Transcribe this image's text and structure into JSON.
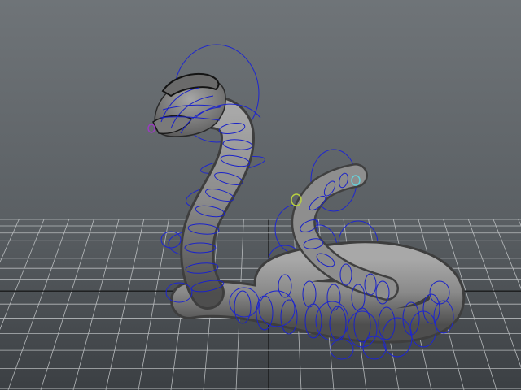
{
  "viewport": {
    "name": "3d-perspective-viewport",
    "background_top": "#6f7478",
    "background_bottom": "#3b3f43",
    "grid_color": "#c9ccce",
    "grid_axis_color": "#111111"
  },
  "model": {
    "name": "snake",
    "mesh_color": "#8a8a8a",
    "wireframe_color": "#1a22c8",
    "rig_control_color": "#1e26d0",
    "highlight_colors": [
      "#66d0d8",
      "#b8d040",
      "#9a3cc0"
    ]
  }
}
